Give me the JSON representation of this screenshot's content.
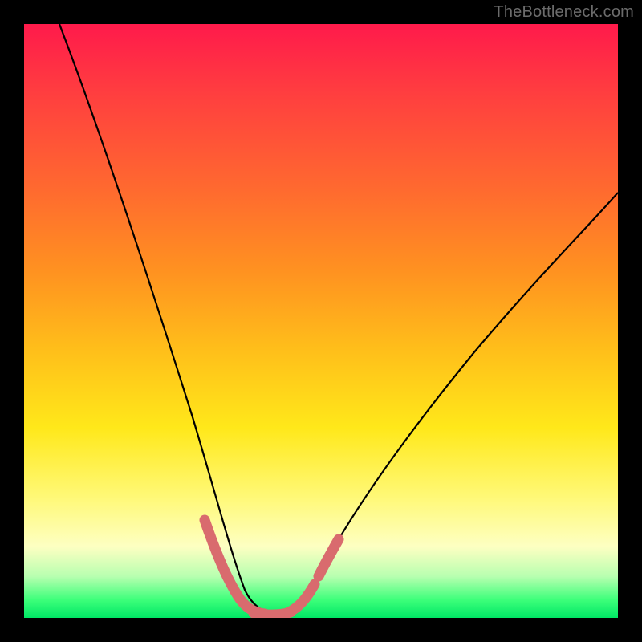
{
  "watermark": {
    "text": "TheBottleneck.com"
  },
  "chart_data": {
    "type": "line",
    "title": "",
    "xlabel": "",
    "ylabel": "",
    "xlim": [
      0,
      100
    ],
    "ylim": [
      0,
      100
    ],
    "grid": false,
    "legend": null,
    "background_gradient_top_to_bottom": [
      "#ff1a4b",
      "#ffe81a",
      "#00e765"
    ],
    "series": [
      {
        "name": "bottleneck-curve",
        "color": "#000000",
        "x": [
          6,
          10,
          14,
          18,
          22,
          26,
          30,
          33,
          35,
          37,
          39,
          41,
          44,
          48,
          55,
          62,
          70,
          78,
          86,
          94,
          100
        ],
        "values": [
          100,
          90,
          79,
          68,
          57,
          46,
          34,
          22,
          14,
          8,
          4,
          2,
          2,
          4,
          10,
          18,
          27,
          36,
          45,
          53,
          59
        ]
      },
      {
        "name": "optimal-zone-marker",
        "color": "#d96b6e",
        "x": [
          30,
          33,
          35,
          37,
          39,
          41,
          44,
          46,
          48
        ],
        "values": [
          16,
          9,
          5,
          3,
          2,
          2,
          3,
          5,
          8
        ]
      }
    ]
  }
}
